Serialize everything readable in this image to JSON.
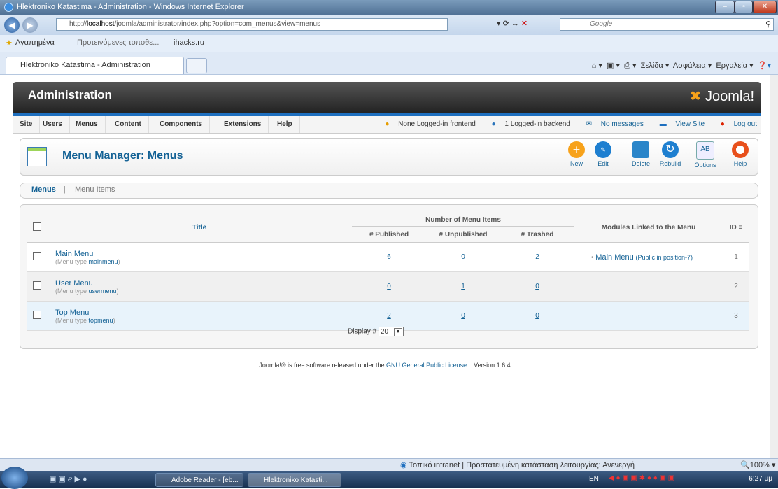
{
  "browser": {
    "window_title": "Hlektroniko Katastima - Administration - Windows Internet Explorer",
    "url_prefix": "http://",
    "url_domain": "localhost",
    "url_rest": "/joomla/administrator/index.php?option=com_menus&view=menus",
    "search_placeholder": "Google",
    "favorites_label": "Αγαπημένα",
    "suggested_sites": "Προτεινόμενες τοποθε...",
    "fav_link": "ihacks.ru",
    "tab_title": "Hlektroniko Katastima - Administration",
    "cmd_page": "Σελίδα ▾",
    "cmd_safety": "Ασφάλεια ▾",
    "cmd_tools": "Εργαλεία ▾",
    "status_text": "Τοπικό intranet | Προστατευμένη κατάσταση λειτουργίας: Ανενεργή",
    "zoom": "100%"
  },
  "admin": {
    "header_title": "Administration",
    "logo_text": "Joomla!",
    "menu": [
      "Site",
      "Users",
      "Menus",
      "Content",
      "Components",
      "Extensions",
      "Help"
    ],
    "status": {
      "frontend": "None Logged-in frontend",
      "backend": "1 Logged-in backend",
      "messages": "No messages",
      "view_site": "View Site",
      "logout": "Log out"
    },
    "page_title": "Menu Manager: Menus",
    "toolbar": {
      "new": "New",
      "edit": "Edit",
      "delete": "Delete",
      "rebuild": "Rebuild",
      "options": "Options",
      "help": "Help"
    },
    "subnav": {
      "menus": "Menus",
      "menu_items": "Menu Items"
    },
    "table": {
      "col_title": "Title",
      "col_group": "Number of Menu Items",
      "col_published": "# Published",
      "col_unpublished": "# Unpublished",
      "col_trashed": "# Trashed",
      "col_modules": "Modules Linked to the Menu",
      "col_id": "ID",
      "rows": [
        {
          "title": "Main Menu",
          "type_prefix": "(Menu type ",
          "type": "mainmenu",
          "type_suffix": ")",
          "published": "6",
          "unpublished": "0",
          "trashed": "2",
          "module": "Main Menu",
          "module_pos": "(Public in position-7)",
          "id": "1"
        },
        {
          "title": "User Menu",
          "type_prefix": "(Menu type ",
          "type": "usermenu",
          "type_suffix": ")",
          "published": "0",
          "unpublished": "1",
          "trashed": "0",
          "module": "",
          "module_pos": "",
          "id": "2"
        },
        {
          "title": "Top Menu",
          "type_prefix": "(Menu type ",
          "type": "topmenu",
          "type_suffix": ")",
          "published": "2",
          "unpublished": "0",
          "trashed": "0",
          "module": "",
          "module_pos": "",
          "id": "3"
        }
      ]
    },
    "display_label": "Display #",
    "display_value": "20",
    "footer_pre": "Joomla!® is free software released under the ",
    "footer_link": "GNU General Public License.",
    "footer_version": "Version 1.6.4"
  },
  "taskbar": {
    "task1": "Adobe Reader - [eb...",
    "task2": "Hlektroniko Katasti...",
    "lang": "EN",
    "clock": "6:27 μμ"
  }
}
